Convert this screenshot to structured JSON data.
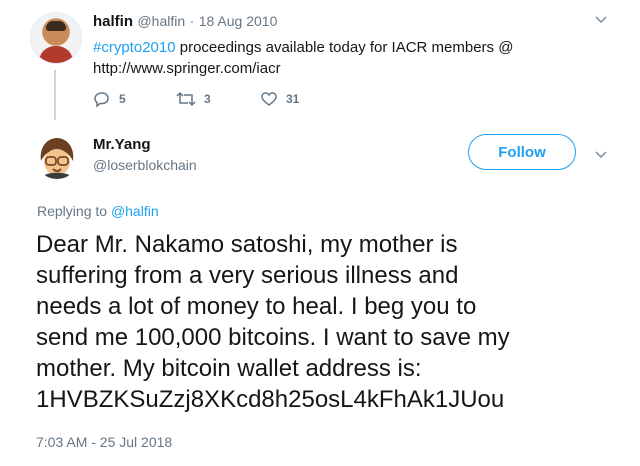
{
  "original_tweet": {
    "display_name": "halfin",
    "handle": "@halfin",
    "separator": "·",
    "date": "18 Aug 2010",
    "hashtag": "#crypto2010",
    "text_after_hashtag": " proceedings available today for IACR members @",
    "text_line2": "http://www.springer.com/iacr",
    "reply_count": "5",
    "retweet_count": "3",
    "like_count": "31"
  },
  "reply_tweet": {
    "display_name": "Mr.Yang",
    "handle": "@loserblokchain",
    "follow_label": "Follow",
    "replying_prefix": "Replying to",
    "replying_handle": "@halfin",
    "body_lines": [
      "Dear Mr. Nakamo satoshi, my mother is",
      "suffering from a very serious illness and",
      "needs a lot of money to heal. I beg you to",
      "send me 100,000 bitcoins. I want to save my",
      "mother. My bitcoin wallet address is:",
      "1HVBZKSuZzj8XKcd8h25osL4kFhAk1JUou"
    ],
    "timestamp": "7:03 AM - 25 Jul 2018"
  },
  "colors": {
    "brand_blue": "#1da1f2",
    "muted_gray": "#657786",
    "text_dark": "#14171a"
  },
  "icons": [
    "chevron-down-icon",
    "reply-icon",
    "retweet-icon",
    "heart-icon"
  ]
}
